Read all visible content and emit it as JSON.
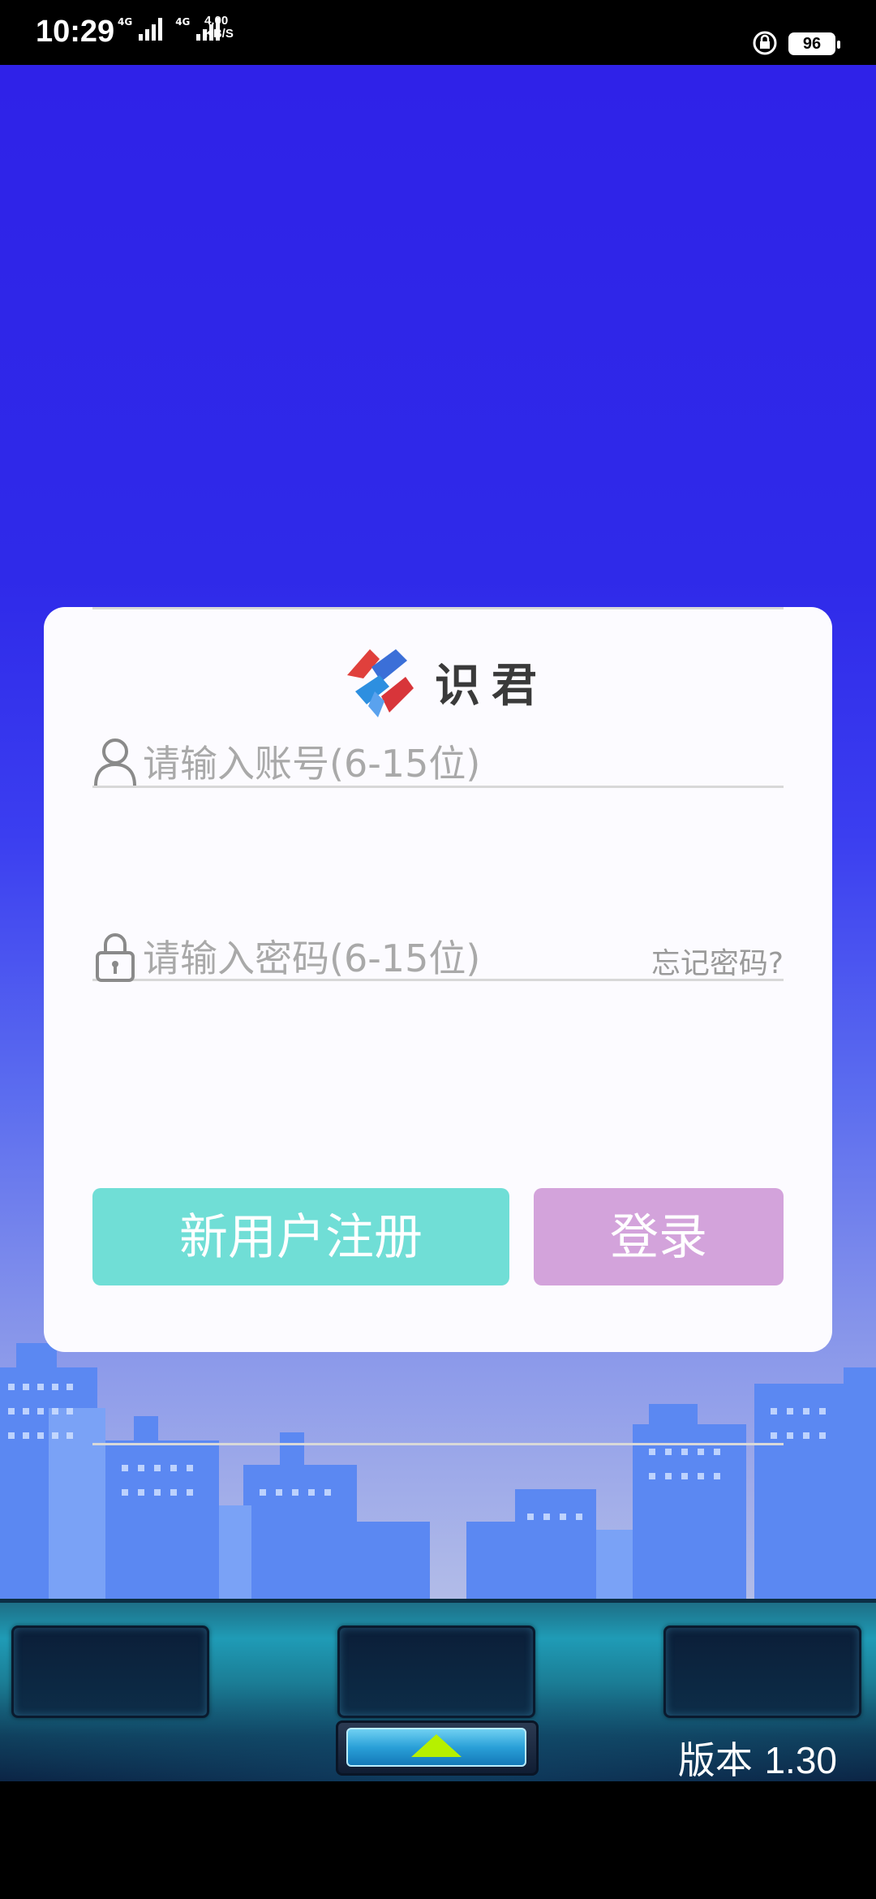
{
  "status_bar": {
    "time": "10:29",
    "network_label_1": "4G",
    "network_label_2": "4G",
    "speed_value": "4.00",
    "speed_unit": "KB/S",
    "battery": "96"
  },
  "logo": {
    "text": "识君"
  },
  "login": {
    "account_placeholder": "请输入账号(6-15位)",
    "password_placeholder": "请输入密码(6-15位)",
    "forgot_password": "忘记密码?",
    "register_button": "新用户注册",
    "login_button": "登录"
  },
  "footer": {
    "version_label": "版本",
    "version_number": "1.30"
  },
  "colors": {
    "background_top": "#2f22e8",
    "register_button": "#70ded6",
    "login_button": "#d3a3db",
    "arrow": "#b6f000"
  }
}
